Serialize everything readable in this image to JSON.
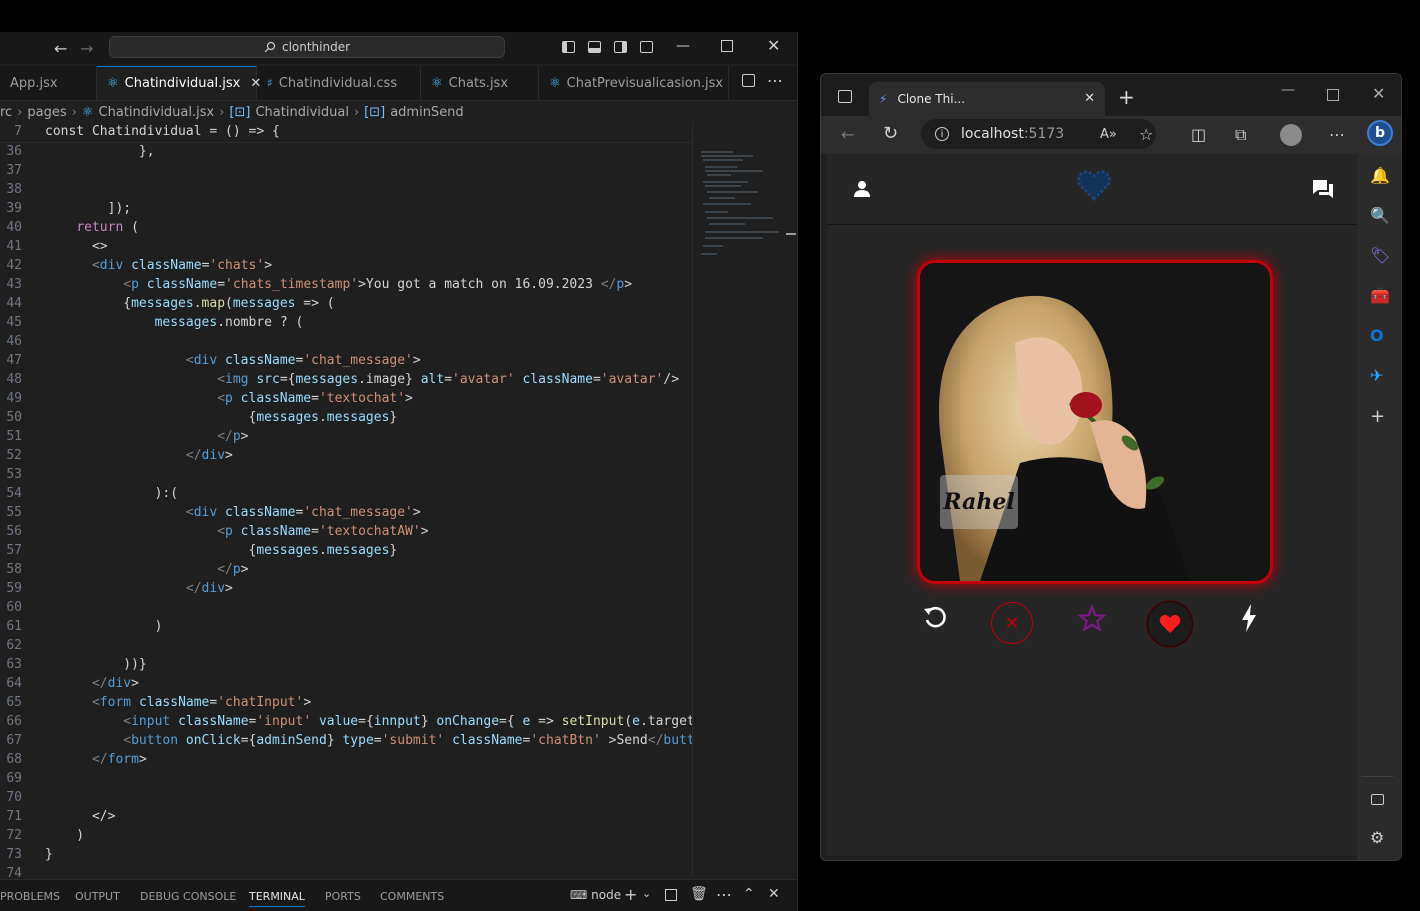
{
  "vscode": {
    "search": "clonthinder",
    "tabs": [
      {
        "label": "App.jsx",
        "type": "jsx"
      },
      {
        "label": "Chatindividual.jsx",
        "type": "jsx",
        "active": true
      },
      {
        "label": "Chatindividual.css",
        "type": "css"
      },
      {
        "label": "Chats.jsx",
        "type": "jsx"
      },
      {
        "label": "ChatPrevisualicasion.jsx",
        "type": "jsx"
      }
    ],
    "breadcrumb": [
      "rc",
      "pages",
      "Chatindividual.jsx",
      "Chatindividual",
      "adminSend"
    ],
    "sticky_line_number": "7",
    "sticky_line": "const Chatindividual = () => {",
    "code": [
      {
        "n": "36",
        "t": "            },"
      },
      {
        "n": "37",
        "t": ""
      },
      {
        "n": "38",
        "t": ""
      },
      {
        "n": "39",
        "t": "        ]);"
      },
      {
        "n": "40",
        "t": "    return ("
      },
      {
        "n": "41",
        "t": "      <>"
      },
      {
        "n": "42",
        "t": "      <div className='chats'>"
      },
      {
        "n": "43",
        "t": "          <p className='chats_timestamp'>You got a match on 16.09.2023 </p>"
      },
      {
        "n": "44",
        "t": "          {messages.map(messages => ("
      },
      {
        "n": "45",
        "t": "              messages.nombre ? ("
      },
      {
        "n": "46",
        "t": ""
      },
      {
        "n": "47",
        "t": "                  <div className='chat_message'>"
      },
      {
        "n": "48",
        "t": "                      <img src={messages.image} alt='avatar' className='avatar'/>"
      },
      {
        "n": "49",
        "t": "                      <p className='textochat'>"
      },
      {
        "n": "50",
        "t": "                          {messages.messages}"
      },
      {
        "n": "51",
        "t": "                      </p>"
      },
      {
        "n": "52",
        "t": "                  </div>"
      },
      {
        "n": "53",
        "t": ""
      },
      {
        "n": "54",
        "t": "              ):("
      },
      {
        "n": "55",
        "t": "                  <div className='chat_message'>"
      },
      {
        "n": "56",
        "t": "                      <p className='textochatAW'>"
      },
      {
        "n": "57",
        "t": "                          {messages.messages}"
      },
      {
        "n": "58",
        "t": "                      </p>"
      },
      {
        "n": "59",
        "t": "                  </div>"
      },
      {
        "n": "60",
        "t": ""
      },
      {
        "n": "61",
        "t": "              )"
      },
      {
        "n": "62",
        "t": ""
      },
      {
        "n": "63",
        "t": "          ))}"
      },
      {
        "n": "64",
        "t": "      </div>"
      },
      {
        "n": "65",
        "t": "      <form className='chatInput'>"
      },
      {
        "n": "66",
        "t": "          <input className='input' value={innput} onChange={ e => setInput(e.target.va"
      },
      {
        "n": "67",
        "t": "          <button onClick={adminSend} type='submit' className='chatBtn' >Send</button>"
      },
      {
        "n": "68",
        "t": "      </form>"
      },
      {
        "n": "69",
        "t": ""
      },
      {
        "n": "70",
        "t": ""
      },
      {
        "n": "71",
        "t": "      </>"
      },
      {
        "n": "72",
        "t": "    )"
      },
      {
        "n": "73",
        "t": "}"
      },
      {
        "n": "74",
        "t": ""
      }
    ],
    "panel_tabs": [
      "PROBLEMS",
      "OUTPUT",
      "DEBUG CONSOLE",
      "TERMINAL",
      "PORTS",
      "COMMENTS"
    ],
    "terminal_name": "node"
  },
  "edge": {
    "tab_title": "Clone Thi...",
    "url_host": "localhost",
    "url_port": ":5173"
  },
  "app": {
    "profile_name": "Rahel",
    "colors": {
      "accent": "#c4000b",
      "star": "#7d1a86",
      "heart": "#ff1c1c"
    }
  }
}
